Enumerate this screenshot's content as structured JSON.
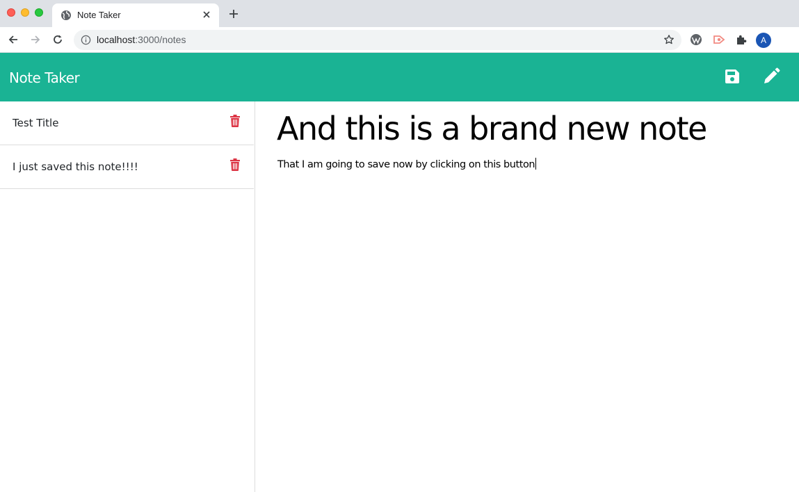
{
  "browser": {
    "tab_title": "Note Taker",
    "url_host": "localhost",
    "url_path": ":3000/notes",
    "profile_initial": "A"
  },
  "app": {
    "brand": "Note Taker",
    "accent_color": "#1ab394",
    "delete_color": "#dc3545"
  },
  "notes": [
    {
      "title": "Test Title"
    },
    {
      "title": "I just saved this note!!!!"
    }
  ],
  "editor": {
    "title_value": "And this is a brand new note",
    "body_value": "That I am going to save now by clicking on this button"
  },
  "icons": {
    "save": "save-icon",
    "new": "pencil-icon",
    "delete": "trash-icon"
  }
}
